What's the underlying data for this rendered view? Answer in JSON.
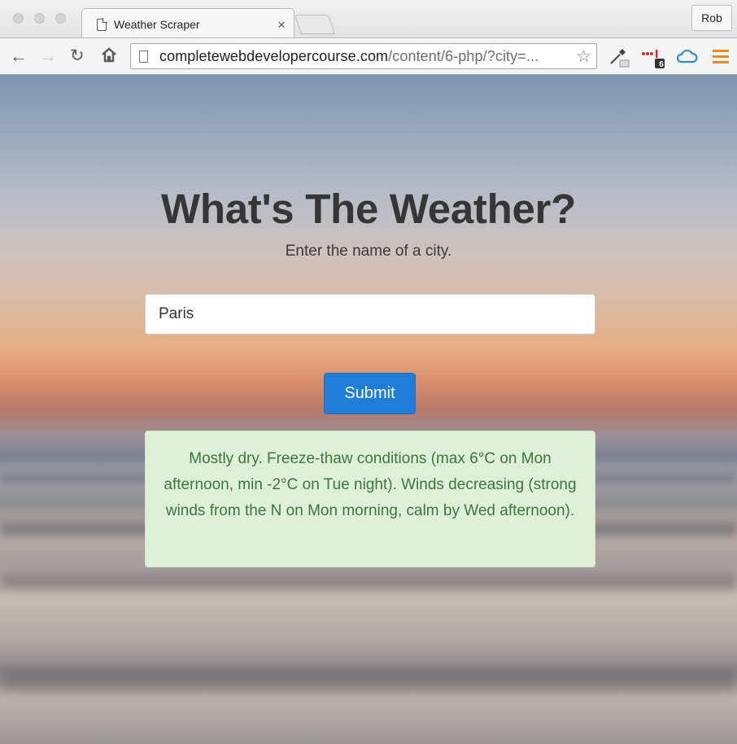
{
  "browser": {
    "tab_title": "Weather Scraper",
    "tab_close": "×",
    "profile_name": "Rob",
    "url_domain": "completewebdevelopercourse.com",
    "url_path": "/content/6-php/?city=..."
  },
  "page": {
    "heading": "What's The Weather?",
    "subheading": "Enter the name of a city.",
    "city_input_value": "Paris",
    "submit_label": "Submit",
    "forecast": "Mostly dry. Freeze-thaw conditions (max 6°C on Mon afternoon, min -2°C on Tue night). Winds decreasing (strong winds from the N on Mon morning, calm by Wed afternoon)."
  },
  "extensions": {
    "badge_count": "6"
  },
  "colors": {
    "submit_button": "#1f7fd8",
    "forecast_background": "#dff0d8",
    "forecast_text": "#3c763d",
    "heading_text": "#363636"
  }
}
